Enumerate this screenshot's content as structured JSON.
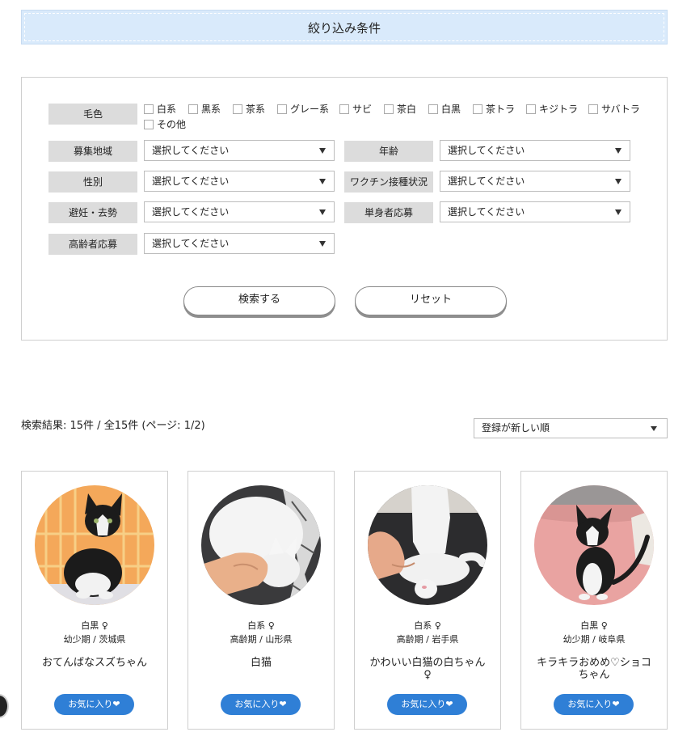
{
  "filter": {
    "title": "絞り込み条件",
    "labels": {
      "color": "毛色",
      "region": "募集地域",
      "age": "年齢",
      "gender": "性別",
      "vaccine": "ワクチン接種状況",
      "neuter": "避妊・去勢",
      "single": "単身者応募",
      "senior": "高齢者応募"
    },
    "colors": [
      "白系",
      "黒系",
      "茶系",
      "グレー系",
      "サビ",
      "茶白",
      "白黒",
      "茶トラ",
      "キジトラ",
      "サバトラ",
      "その他"
    ],
    "select_placeholder": "選択してください",
    "search_button": "検索する",
    "reset_button": "リセット"
  },
  "results": {
    "summary": "検索結果: 15件 / 全15件 (ページ: 1/2)",
    "sort_selected": "登録が新しい順"
  },
  "cards": [
    {
      "color_gender": "白黒 ♀",
      "age_region": "幼少期 / 茨城県",
      "name": "おてんばなスズちゃん",
      "fav": "お気に入り❤"
    },
    {
      "color_gender": "白系 ♀",
      "age_region": "高齢期 / 山形県",
      "name": "白猫",
      "fav": "お気に入り❤"
    },
    {
      "color_gender": "白系 ♀",
      "age_region": "高齢期 / 岩手県",
      "name": "かわいい白猫の白ちゃん♀",
      "fav": "お気に入り❤"
    },
    {
      "color_gender": "白黒 ♀",
      "age_region": "幼少期 / 岐阜県",
      "name": "キラキラおめめ♡ショコちゃん",
      "fav": "お気に入り❤"
    }
  ],
  "colors": {
    "header_bg": "#d9eafb",
    "accent": "#2f7fd6",
    "label_bg": "#dcdcdc"
  }
}
